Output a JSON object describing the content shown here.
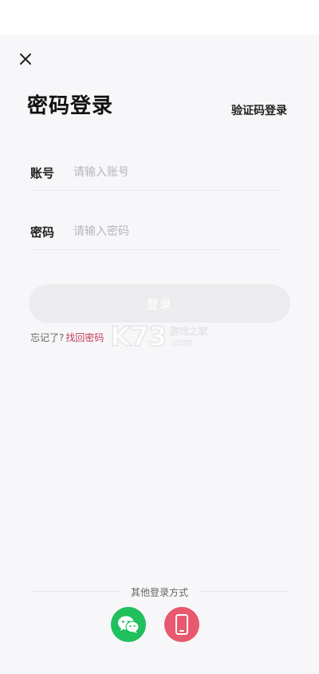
{
  "header": {
    "close_icon": "close-icon",
    "title": "密码登录",
    "switch_link": "验证码登录"
  },
  "form": {
    "account": {
      "label": "账号",
      "placeholder": "请输入账号"
    },
    "password": {
      "label": "密码",
      "placeholder": "请输入密码"
    },
    "login_button": "登录",
    "forgot_question": "忘记了?",
    "forgot_link": "找回密码"
  },
  "other_login": {
    "title": "其他登录方式",
    "options": [
      {
        "icon": "wechat-icon",
        "color": "#20c05c"
      },
      {
        "icon": "phone-icon",
        "color": "#e8586e"
      }
    ]
  },
  "watermark": {
    "logo": "K73",
    "line1": "游戏之家",
    "line2": ".com"
  },
  "colors": {
    "background": "#f7f7f9",
    "link": "#c23b5a",
    "button_disabled": "#ececef"
  }
}
